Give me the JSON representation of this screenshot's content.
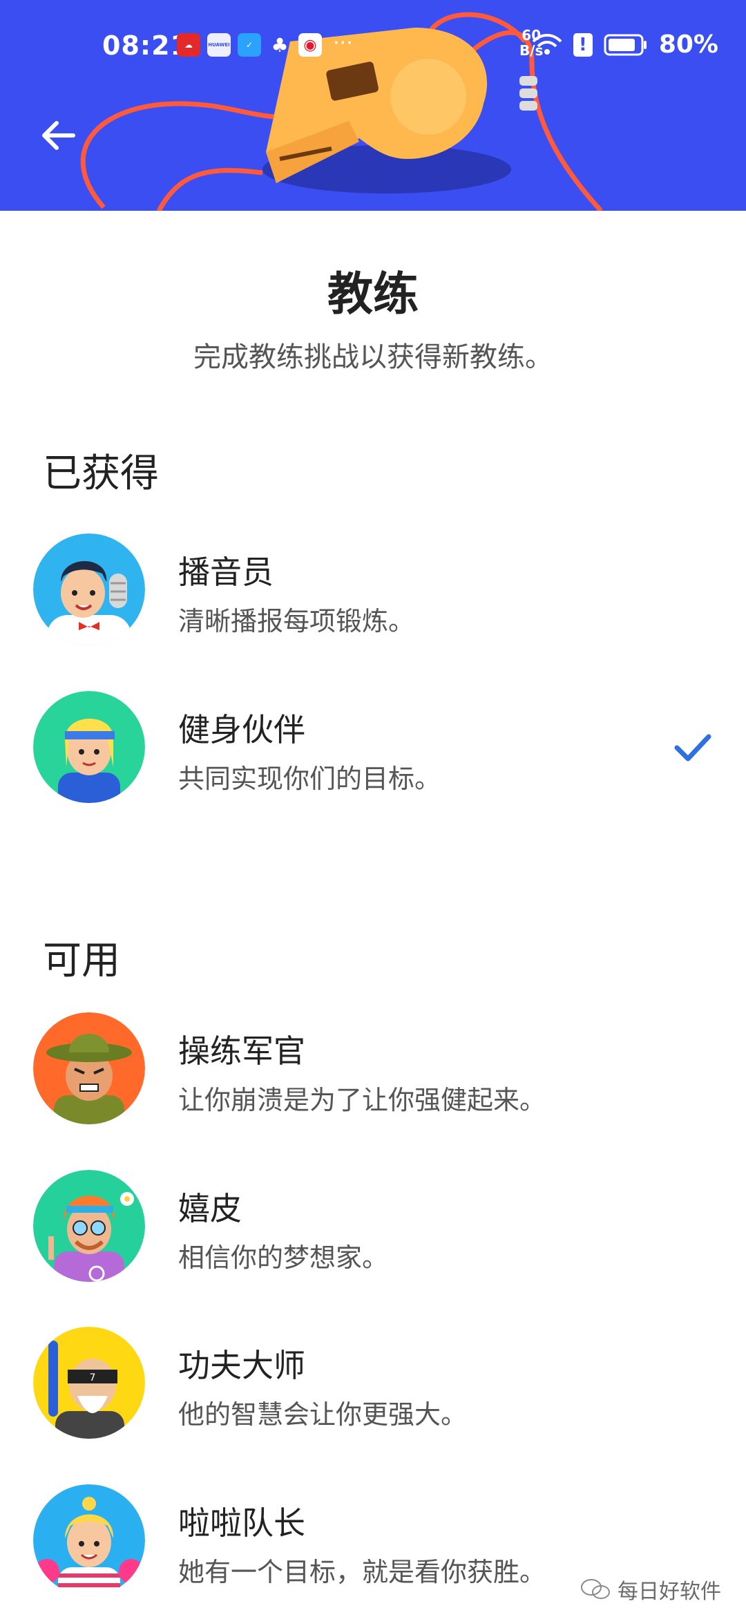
{
  "status_bar": {
    "time": "08:21",
    "net_speed_value": "60",
    "net_speed_unit": "B/s",
    "battery_percent": "80%",
    "notification_icons": [
      "cloud-app-icon",
      "huawei-app-icon",
      "shield-app-icon",
      "cherry-app-icon",
      "weibo-app-icon"
    ],
    "huawei_label": "HUAWEI",
    "alert_glyph": "!",
    "more_dots": "···"
  },
  "header": {
    "banner_color": "#3b4ef2",
    "whistle_color": "#ffb84d",
    "cord_color": "#ff5a3c"
  },
  "page": {
    "title": "教练",
    "subtitle": "完成教练挑战以获得新教练。"
  },
  "sections": {
    "earned_title": "已获得",
    "available_title": "可用"
  },
  "earned_coaches": [
    {
      "name": "播音员",
      "desc": "清晰播报每项锻炼。",
      "selected": false
    },
    {
      "name": "健身伙伴",
      "desc": "共同实现你们的目标。",
      "selected": true
    }
  ],
  "available_coaches": [
    {
      "name": "操练军官",
      "desc": "让你崩溃是为了让你强健起来。"
    },
    {
      "name": "嬉皮",
      "desc": "相信你的梦想家。"
    },
    {
      "name": "功夫大师",
      "desc": "他的智慧会让你更强大。"
    },
    {
      "name": "啦啦队长",
      "desc": "她有一个目标，就是看你获胜。"
    }
  ],
  "watermark": {
    "text": "每日好软件"
  },
  "colors": {
    "accent_check": "#2f6fe0"
  }
}
